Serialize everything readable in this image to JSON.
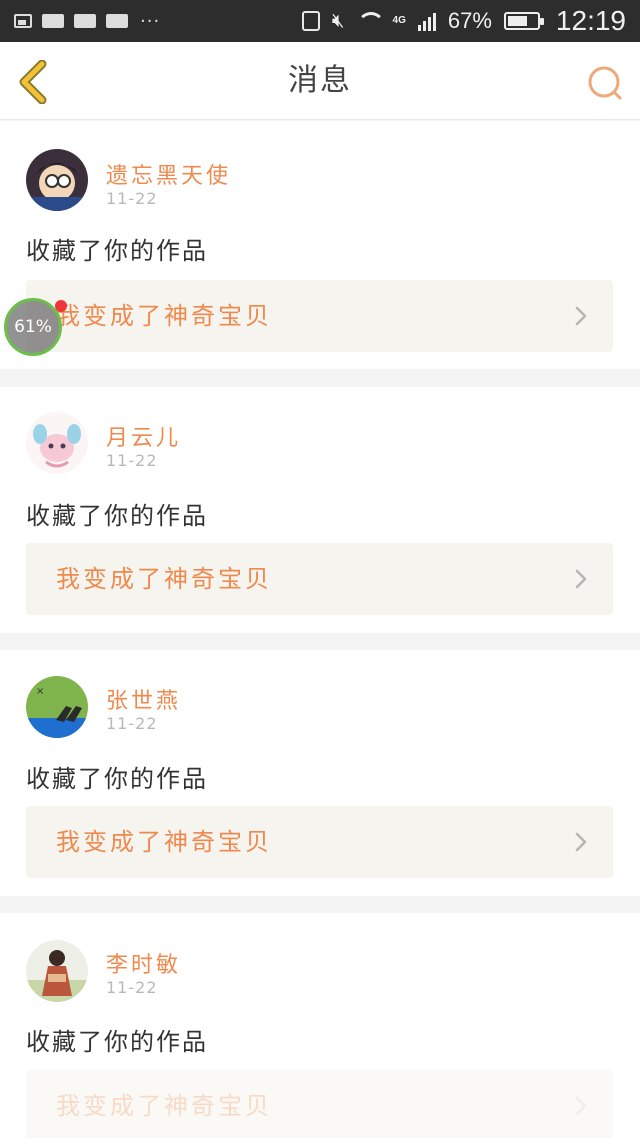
{
  "status_bar": {
    "battery_percent": "67%",
    "battery_level": 0.67,
    "network": "4G",
    "time": "12:19",
    "icons": [
      "image-icon",
      "mail-icon",
      "mail-icon",
      "mail-icon",
      "more-icon",
      "sim-icon",
      "mute-icon",
      "wifi-icon",
      "signal-icon",
      "battery-icon"
    ]
  },
  "nav": {
    "title": "消息",
    "back_icon": "chevron-left-icon",
    "search_icon": "search-icon"
  },
  "colors": {
    "accent": "#ef8a4f",
    "back_arrow": "#f2c23a",
    "search": "#f0a878",
    "divider": "#f4f4f4",
    "float_ring": "#6cc04a",
    "notify_dot": "#f0353a"
  },
  "messages": [
    {
      "name": "遗忘黑天使",
      "date": "11-22",
      "action": "收藏了你的作品",
      "work_title": "我变成了神奇宝贝"
    },
    {
      "name": "月云儿",
      "date": "11-22",
      "action": "收藏了你的作品",
      "work_title": "我变成了神奇宝贝"
    },
    {
      "name": "张世燕",
      "date": "11-22",
      "action": "收藏了你的作品",
      "work_title": "我变成了神奇宝贝"
    },
    {
      "name": "李时敏",
      "date": "11-22",
      "action": "收藏了你的作品",
      "work_title": "我变成了神奇宝贝"
    }
  ],
  "float_ball": {
    "label": "61%"
  }
}
